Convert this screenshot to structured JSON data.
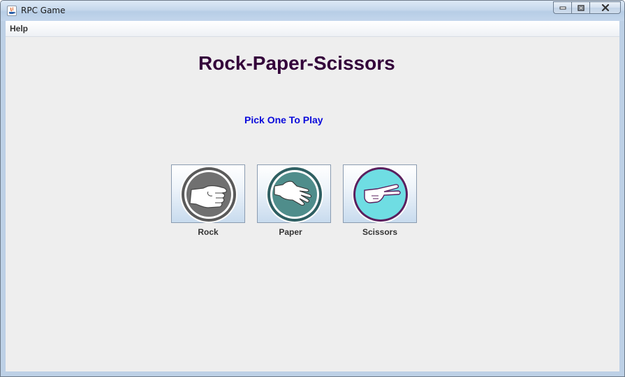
{
  "window": {
    "title": "RPC Game",
    "controls": [
      "minimize-icon",
      "maximize-icon",
      "close-icon"
    ]
  },
  "menu": {
    "items": [
      {
        "label": "Help"
      }
    ]
  },
  "game": {
    "heading": "Rock-Paper-Scissors",
    "prompt": "Pick One To Play",
    "choices": [
      {
        "label": "Rock",
        "icon": "fist-icon",
        "color": "#6e6e6e"
      },
      {
        "label": "Paper",
        "icon": "open-hand-icon",
        "color": "#4e8a8a"
      },
      {
        "label": "Scissors",
        "icon": "two-fingers-icon",
        "color": "#6cd8e0"
      }
    ]
  },
  "colors": {
    "heading": "#33003a",
    "prompt": "#0a0adb",
    "background": "#eeeeee"
  }
}
